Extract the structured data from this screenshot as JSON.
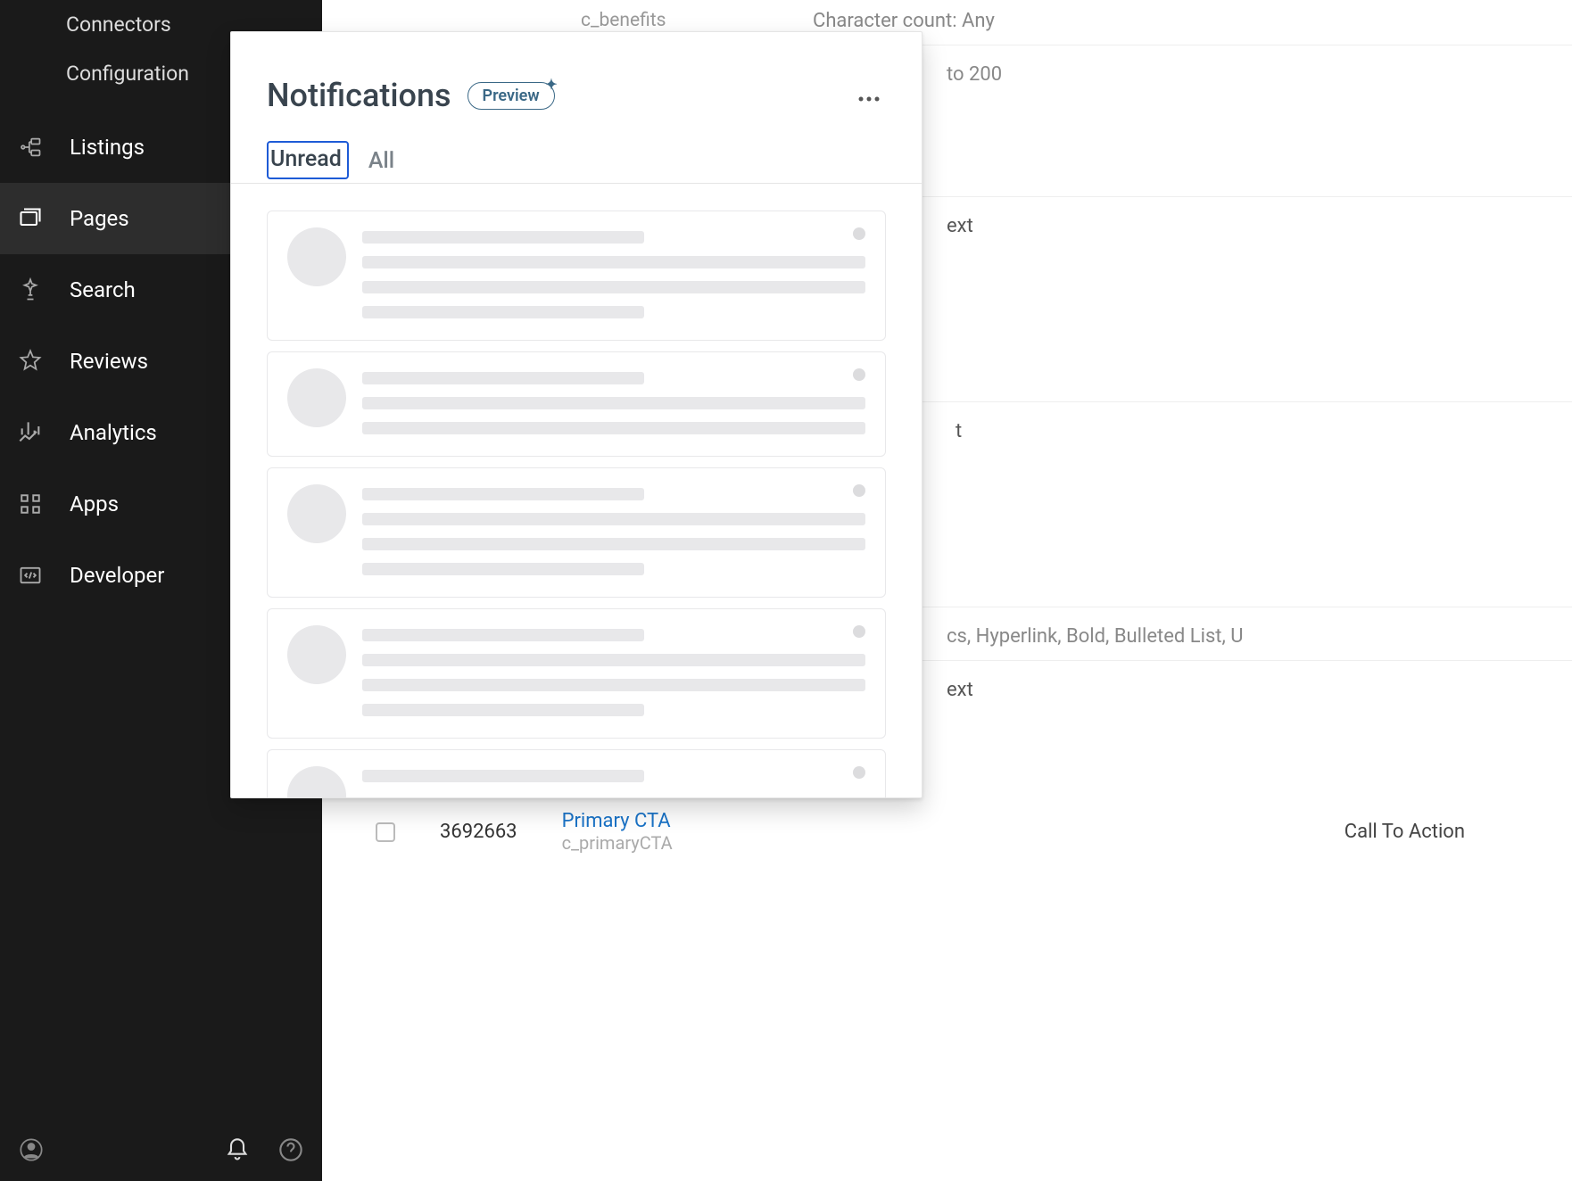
{
  "sidebar": {
    "sub_items": [
      {
        "label": "Connectors"
      },
      {
        "label": "Configuration"
      }
    ],
    "items": [
      {
        "label": "Listings",
        "icon": "listings"
      },
      {
        "label": "Pages",
        "icon": "pages",
        "active": true
      },
      {
        "label": "Search",
        "icon": "search"
      },
      {
        "label": "Reviews",
        "icon": "reviews"
      },
      {
        "label": "Analytics",
        "icon": "analytics"
      },
      {
        "label": "Apps",
        "icon": "apps"
      },
      {
        "label": "Developer",
        "icon": "developer"
      }
    ]
  },
  "background": {
    "field1_api": "c_benefits",
    "char_count": "Character count: Any",
    "to200": "to 200",
    "ext1": "ext",
    "t1": "t",
    "formatting": "cs, Hyperlink, Bold, Bulleted List, U",
    "ext2": "ext",
    "row": {
      "id": "3692663",
      "link": "Primary CTA",
      "api": "c_primaryCTA",
      "type": "Call To Action"
    }
  },
  "notifications": {
    "title": "Notifications",
    "preview_label": "Preview",
    "tabs": {
      "unread": "Unread",
      "all": "All"
    }
  }
}
